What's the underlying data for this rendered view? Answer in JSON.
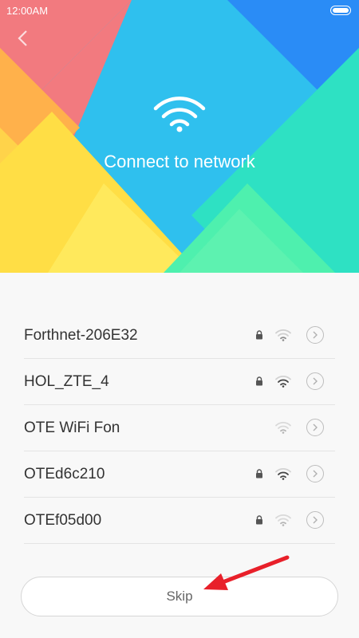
{
  "status_bar": {
    "time": "12:00AM"
  },
  "header": {
    "title": "Connect to network"
  },
  "networks": [
    {
      "name": "Forthnet-206E32",
      "secured": true,
      "signal": "weak"
    },
    {
      "name": "HOL_ZTE_4",
      "secured": true,
      "signal": "strong"
    },
    {
      "name": "OTE WiFi Fon",
      "secured": false,
      "signal": "weak"
    },
    {
      "name": "OTEd6c210",
      "secured": true,
      "signal": "strong"
    },
    {
      "name": "OTEf05d00",
      "secured": true,
      "signal": "weak"
    }
  ],
  "actions": {
    "skip_label": "Skip"
  },
  "icons": {
    "back": "chevron-left-icon",
    "hero": "wifi-icon",
    "lock": "lock-icon",
    "signal": "wifi-signal-icon",
    "detail": "chevron-right-circle-icon",
    "annotation": "red-arrow"
  },
  "colors": {
    "hero_center": "#2FC0EE",
    "accent_red": "#E8202A",
    "text_primary": "#333333",
    "background": "#F8F8F8"
  }
}
